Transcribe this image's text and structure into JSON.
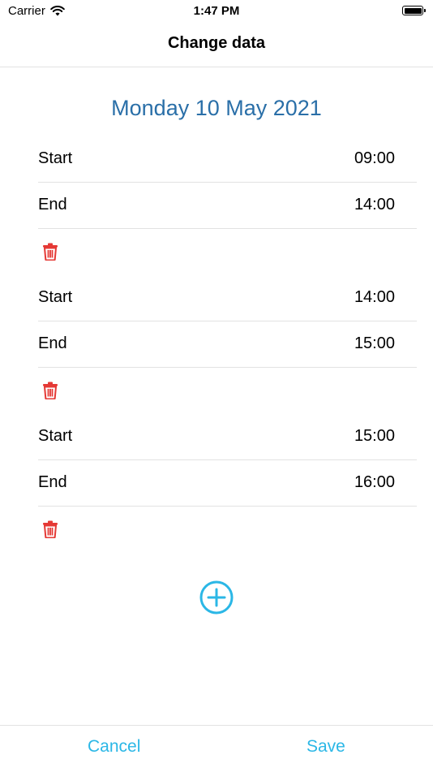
{
  "status": {
    "carrier": "Carrier",
    "time": "1:47 PM"
  },
  "nav": {
    "title": "Change data"
  },
  "date": "Monday 10 May 2021",
  "entries": [
    {
      "start_label": "Start",
      "start": "09:00",
      "end_label": "End",
      "end": "14:00"
    },
    {
      "start_label": "Start",
      "start": "14:00",
      "end_label": "End",
      "end": "15:00"
    },
    {
      "start_label": "Start",
      "start": "15:00",
      "end_label": "End",
      "end": "16:00"
    }
  ],
  "footer": {
    "cancel": "Cancel",
    "save": "Save"
  },
  "colors": {
    "accent": "#2bb7e6",
    "date": "#2a6fa8",
    "delete": "#e53935"
  },
  "icons": {
    "delete": "trash-icon",
    "add": "plus-circle-icon",
    "wifi": "wifi-icon",
    "battery": "battery-icon"
  }
}
